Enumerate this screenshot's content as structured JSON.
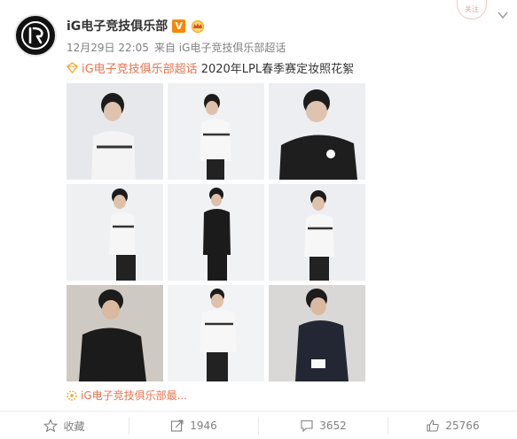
{
  "post": {
    "user_name": "iG电子竞技俱乐部",
    "vip_badge": "V",
    "timestamp": "12月29日 22:05",
    "source": "来自 iG电子竞技俱乐部超话",
    "topic_link": "iG电子竞技俱乐部超话",
    "text": "2020年LPL春季赛定妆照花絮",
    "more_link": "iG电子竞技俱乐部最..."
  },
  "watermark": {
    "text": "关注"
  },
  "photos": [
    {
      "desc": "player-white-jersey-1"
    },
    {
      "desc": "player-white-jersey-2"
    },
    {
      "desc": "player-black-jersey-1"
    },
    {
      "desc": "player-white-jersey-3"
    },
    {
      "desc": "player-black-tracksuit"
    },
    {
      "desc": "player-white-jersey-4"
    },
    {
      "desc": "player-black-jersey-seated"
    },
    {
      "desc": "player-white-jersey-5"
    },
    {
      "desc": "coach-suit-seated"
    }
  ],
  "actions": {
    "favorite_label": "收藏",
    "repost_count": "1946",
    "comment_count": "3652",
    "like_count": "25766"
  },
  "colors": {
    "link": "#eb7350",
    "vip": "#f78800",
    "meta": "#808080"
  }
}
